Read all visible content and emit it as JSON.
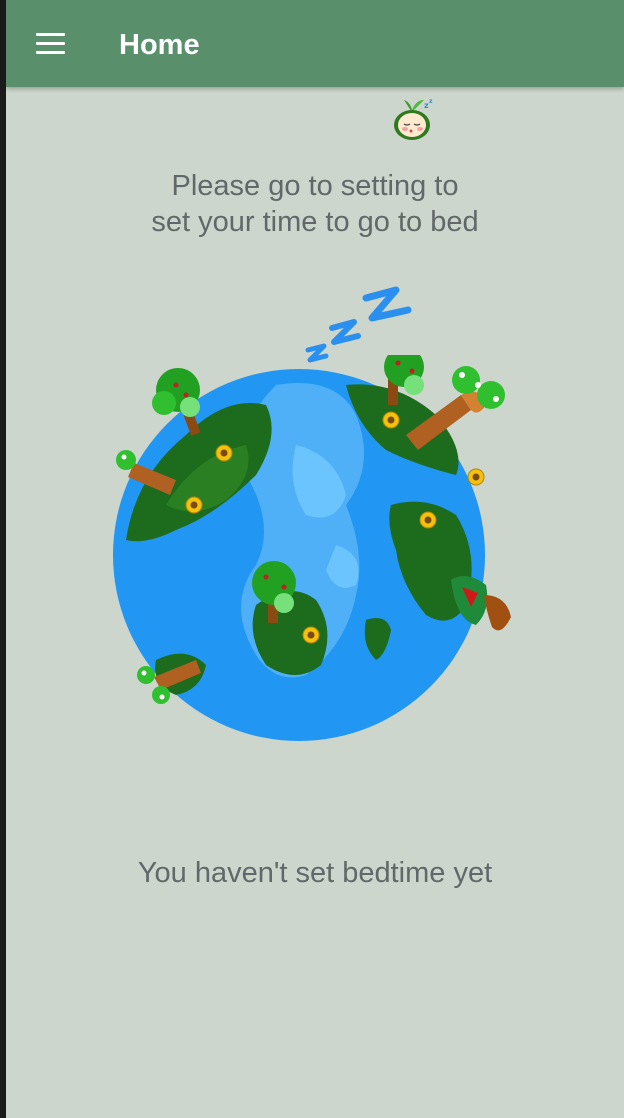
{
  "appbar": {
    "title": "Home",
    "color": "#5a8f6c"
  },
  "background": "#ccd6cc",
  "prompt": {
    "line1": "Please go to setting to",
    "line2": "set your time to go to bed"
  },
  "status": {
    "text": "You haven't set bedtime yet"
  },
  "icons": {
    "menu": "hamburger-menu-icon",
    "mascot": "sleeping-seedling-mascot",
    "sleep": "zzz-sleep-icon",
    "illustration": "sleeping-earth-illustration"
  }
}
